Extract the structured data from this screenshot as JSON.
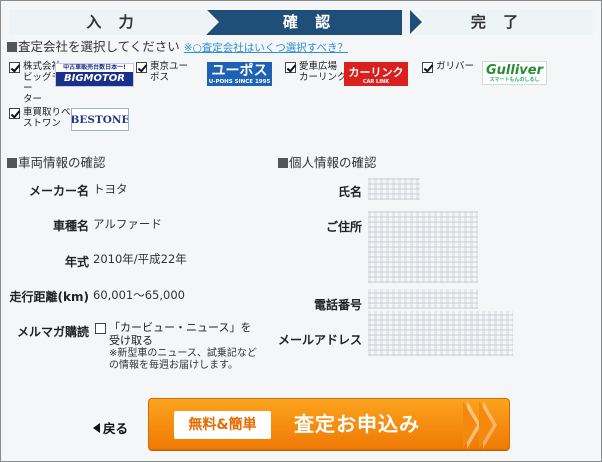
{
  "steps": [
    "入 力",
    "確 認",
    "完 了"
  ],
  "company_section": {
    "title": "査定会社を選択してください",
    "help_link": "※○査定会社はいくつ選択すべき？"
  },
  "companies": [
    {
      "name": "株式会社\nビッグモー\nター",
      "logo_top": "中古車販売台数日本一!",
      "logo_main": "BIGMOTOR",
      "checked": true
    },
    {
      "name": "東京ユー\nポス",
      "logo_main": "ユーポス",
      "logo_sub": "U-POHS SINCE 1995",
      "checked": true
    },
    {
      "name": "愛車広場\nカーリンク",
      "logo_main": "カーリンク",
      "logo_sub": "CAR LINK",
      "checked": true
    },
    {
      "name": "ガリバー",
      "logo_main": "Gulliver",
      "logo_sub": "スマートもんのしるし",
      "checked": true
    },
    {
      "name": "車買取りベ\nストワン",
      "logo_main": "BESTONE",
      "checked": true
    }
  ],
  "vehicle": {
    "title": "車両情報の確認",
    "rows": [
      {
        "label": "メーカー名",
        "value": "トヨタ"
      },
      {
        "label": "車種名",
        "value": "アルファード"
      },
      {
        "label": "年式",
        "value": "2010年/平成22年"
      },
      {
        "label": "走行距離(km)",
        "value": "60,001～65,000"
      }
    ],
    "mailmag_label": "メルマガ購読",
    "mailmag_text": "「カービュー・ニュース」を受け取る",
    "mailmag_note": "※新型車のニュース、試乗記などの情報を毎週お届けします。"
  },
  "personal": {
    "title": "個人情報の確認",
    "labels": [
      "氏名",
      "ご住所",
      "電話番号",
      "メールアドレス"
    ]
  },
  "back_label": "戻る",
  "submit": {
    "badge": "無料&簡単",
    "label": "査定お申込み"
  }
}
